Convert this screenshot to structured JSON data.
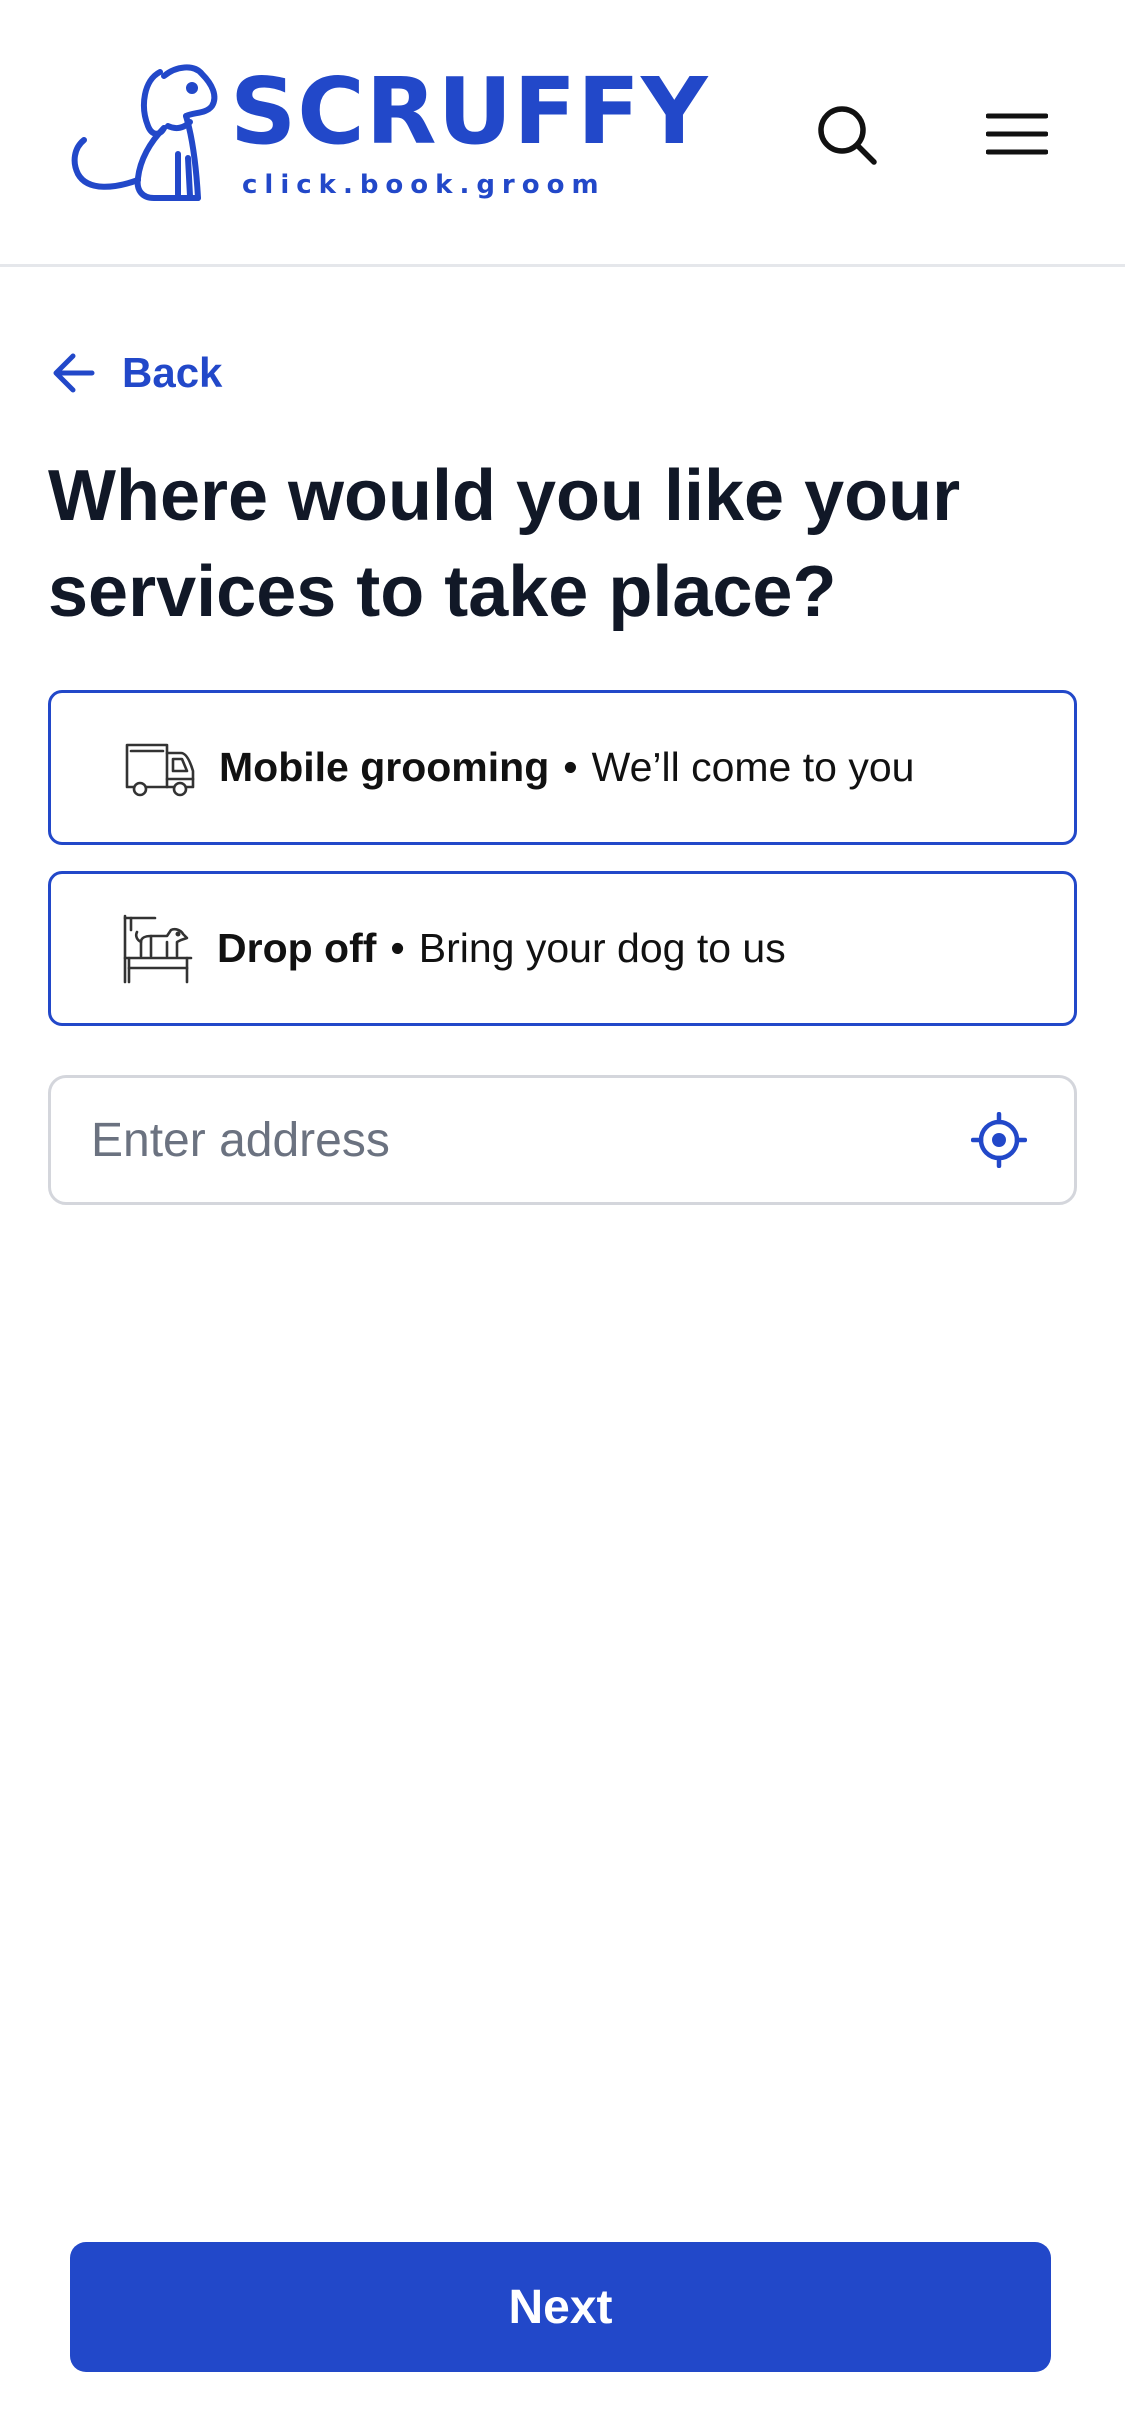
{
  "brand": {
    "name": "SCRUFFY",
    "tagline": "click.book.groom",
    "color": "#2248c9"
  },
  "header": {
    "icons": {
      "search": "search-icon",
      "menu": "hamburger-menu-icon"
    }
  },
  "back": {
    "label": "Back",
    "icon": "arrow-left-icon"
  },
  "page": {
    "title": "Where would you like your services to take place?"
  },
  "options": [
    {
      "title": "Mobile grooming",
      "separator": "•",
      "subtitle": "We’ll come to you",
      "icon": "van-icon"
    },
    {
      "title": "Drop off",
      "separator": "•",
      "subtitle": "Bring your dog to us",
      "icon": "dog-grooming-table-icon"
    }
  ],
  "address": {
    "placeholder": "Enter address",
    "value": "",
    "icon": "locate-crosshair-icon"
  },
  "footer": {
    "next_label": "Next"
  },
  "colors": {
    "primary": "#2248c9",
    "text_dark": "#111827",
    "placeholder": "#6b7280",
    "input_border": "#d4d6dc",
    "divider": "#e5e7eb"
  }
}
